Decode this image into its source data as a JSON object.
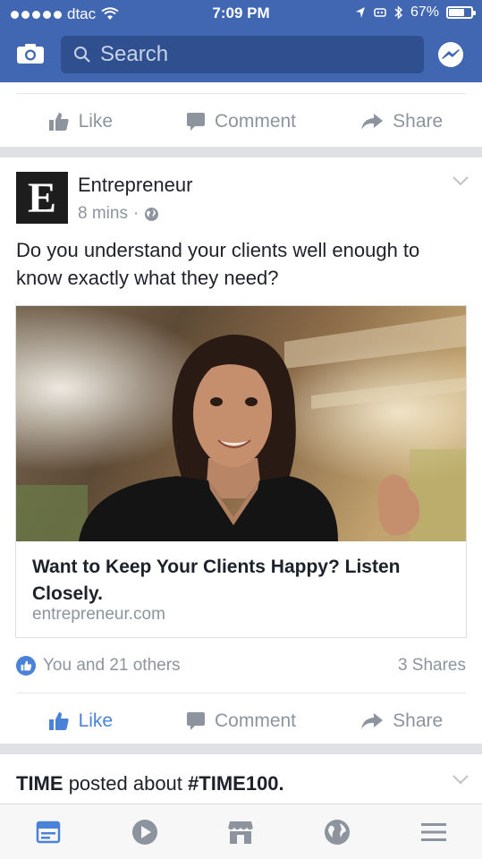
{
  "status_bar": {
    "carrier": "dtac",
    "time": "7:09 PM",
    "battery": "67%",
    "battery_level": 0.67
  },
  "header": {
    "search_placeholder": "Search",
    "camera_icon": "camera-icon",
    "messenger_icon": "messenger-icon"
  },
  "colors": {
    "brand": "#4267b2",
    "accent": "#4a82d9",
    "muted": "#8d949e"
  },
  "previous_post": {
    "actions": {
      "like": "Like",
      "comment": "Comment",
      "share": "Share"
    }
  },
  "post": {
    "author": "Entrepreneur",
    "logo_letter": "E",
    "time": "8 mins",
    "separator": "·",
    "text": "Do you understand your clients well enough to know exactly what they need?",
    "link": {
      "title": "Want to Keep Your Clients Happy? Listen Closely.",
      "domain": "entrepreneur.com"
    },
    "reactions": "You and 21 others",
    "shares": "3 Shares",
    "liked": true,
    "actions": {
      "like": "Like",
      "comment": "Comment",
      "share": "Share"
    }
  },
  "next_post": {
    "author": "TIME",
    "text": "posted about",
    "hashtag": "#TIME100."
  },
  "tabbar": {
    "items": [
      "news-feed-icon",
      "video-icon",
      "marketplace-icon",
      "notifications-globe-icon",
      "menu-icon"
    ]
  }
}
